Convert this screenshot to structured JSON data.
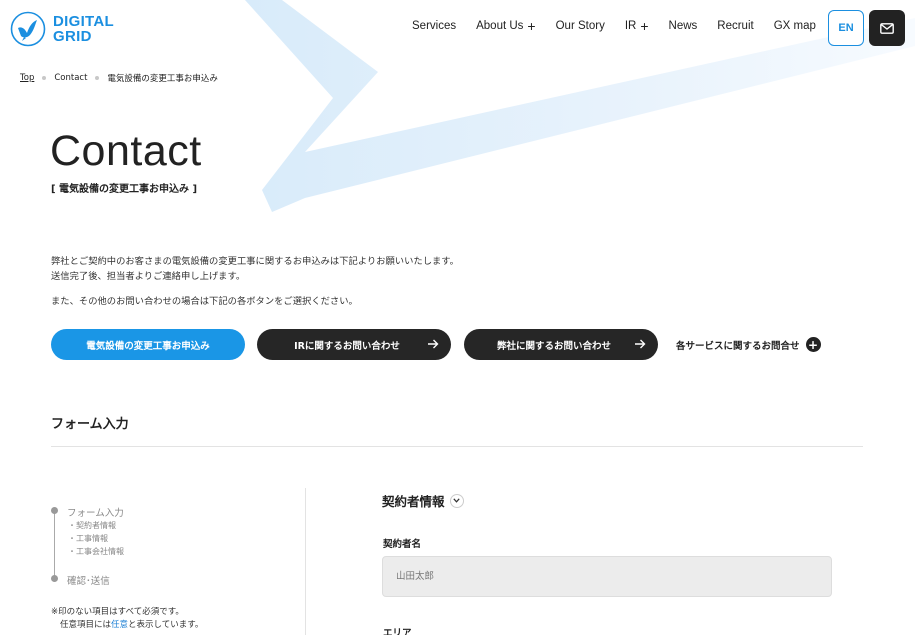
{
  "brand": {
    "line1": "DIGITAL",
    "line2": "GRID",
    "accent_color": "#1b8fe0"
  },
  "nav": {
    "items": [
      {
        "label": "Services",
        "expandable": false
      },
      {
        "label": "About Us",
        "expandable": true
      },
      {
        "label": "Our Story",
        "expandable": false
      },
      {
        "label": "IR",
        "expandable": true
      },
      {
        "label": "News",
        "expandable": false
      },
      {
        "label": "Recruit",
        "expandable": false
      },
      {
        "label": "GX map",
        "expandable": false
      }
    ],
    "plus_glyph": "+",
    "lang_button": "EN",
    "mail_icon": "mail-icon"
  },
  "breadcrumb": [
    "Top",
    "Contact",
    "電気設備の変更工事お申込み"
  ],
  "page": {
    "title": "Contact",
    "subtitle": "[ 電気設備の変更工事お申込み ]",
    "intro_line1": "弊社とご契約中のお客さまの電気設備の変更工事に関するお申込みは下記よりお願いいたします。",
    "intro_line2": "送信完了後、担当者よりご連絡申し上げます。",
    "intro_line3": "また、その他のお問い合わせの場合は下記の各ボタンをご選択ください。"
  },
  "buttons": {
    "primary": "電気設備の変更工事お申込み",
    "ir": "IRに関するお問い合わせ",
    "company": "弊社に関するお問い合わせ",
    "services": "各サービスに関するお問合せ"
  },
  "form": {
    "section_title": "フォーム入力",
    "steps": {
      "step1": "フォーム入力",
      "sub1": "・契約者情報",
      "sub2": "・工事情報",
      "sub3": "・工事会社情報",
      "step2": "確認･送信"
    },
    "note_line1": "※印のない項目はすべて必須です。",
    "note_line2_prefix": "任意項目には",
    "note_line2_em": "任意",
    "note_line2_suffix": "と表示しています。",
    "group_title": "契約者情報",
    "contractor_name_label": "契約者名",
    "contractor_name_placeholder": "山田太郎",
    "area_label": "エリア"
  }
}
